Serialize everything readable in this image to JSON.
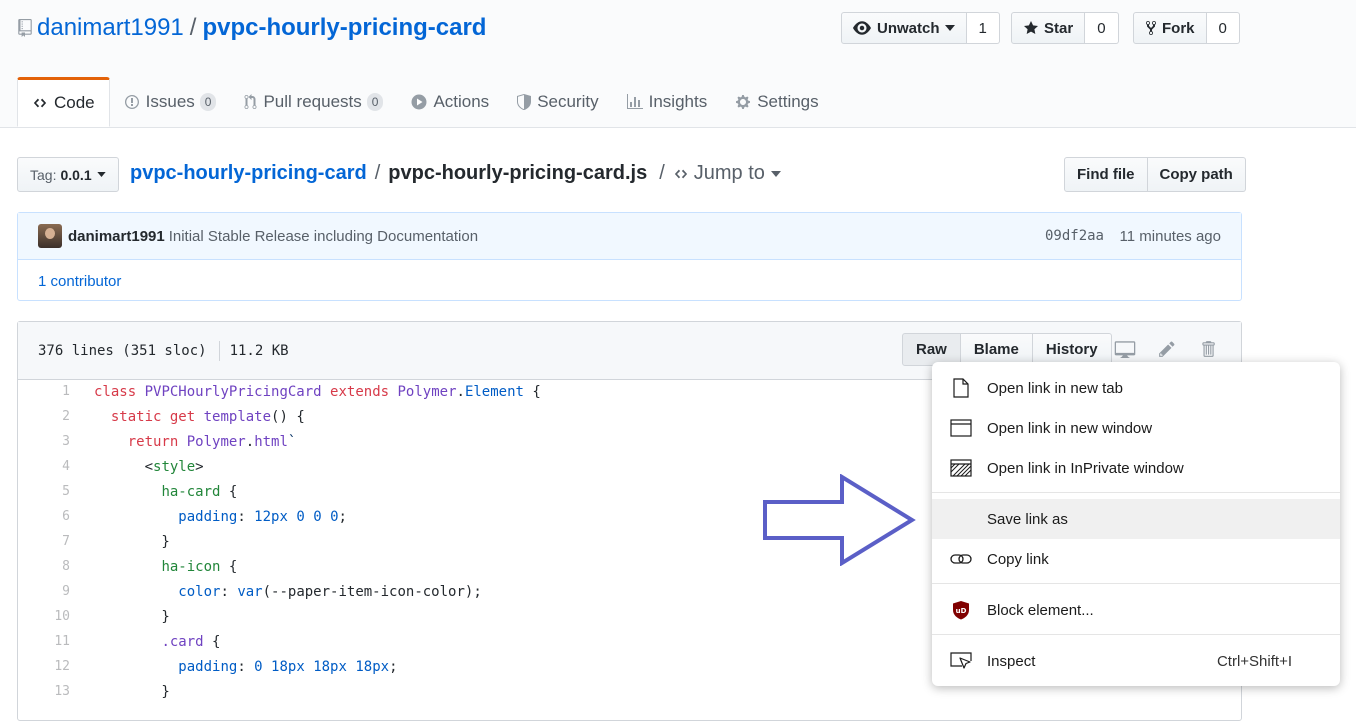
{
  "repo": {
    "owner": "danimart1991",
    "separator": "/",
    "name": "pvpc-hourly-pricing-card",
    "actions": {
      "watch": {
        "label": "Unwatch",
        "count": "1"
      },
      "star": {
        "label": "Star",
        "count": "0"
      },
      "fork": {
        "label": "Fork",
        "count": "0"
      }
    },
    "tabs": [
      {
        "label": "Code",
        "count": ""
      },
      {
        "label": "Issues",
        "count": "0"
      },
      {
        "label": "Pull requests",
        "count": "0"
      },
      {
        "label": "Actions",
        "count": ""
      },
      {
        "label": "Security",
        "count": ""
      },
      {
        "label": "Insights",
        "count": ""
      },
      {
        "label": "Settings",
        "count": ""
      }
    ]
  },
  "filenav": {
    "tag_prefix": "Tag:",
    "tag_value": "0.0.1",
    "crumb_root": "pvpc-hourly-pricing-card",
    "crumb_sep": "/",
    "crumb_file": "pvpc-hourly-pricing-card.js",
    "jump_label": "Jump to",
    "find_file": "Find file",
    "copy_path": "Copy path"
  },
  "commit": {
    "author": "danimart1991",
    "message": "Initial Stable Release including Documentation",
    "sha": "09df2aa",
    "time": "11 minutes ago",
    "contributors": "1 contributor"
  },
  "file": {
    "lines_info": "376 lines (351 sloc)",
    "size": "11.2 KB",
    "raw": "Raw",
    "blame": "Blame",
    "history": "History",
    "line_numbers": [
      "1",
      "2",
      "3",
      "4",
      "5",
      "6",
      "7",
      "8",
      "9",
      "10",
      "11",
      "12",
      "13"
    ]
  },
  "context_menu": {
    "items": [
      {
        "label": "Open link in new tab",
        "icon": "page-icon",
        "shortcut": ""
      },
      {
        "label": "Open link in new window",
        "icon": "window-icon",
        "shortcut": ""
      },
      {
        "label": "Open link in InPrivate window",
        "icon": "inprivate-icon",
        "shortcut": ""
      },
      {
        "label": "Save link as",
        "icon": "",
        "shortcut": ""
      },
      {
        "label": "Copy link",
        "icon": "link-icon",
        "shortcut": ""
      },
      {
        "label": "Block element...",
        "icon": "ublock-icon",
        "shortcut": ""
      },
      {
        "label": "Inspect",
        "icon": "inspect-icon",
        "shortcut": "Ctrl+Shift+I"
      }
    ]
  },
  "colors": {
    "link": "#0366d6",
    "tab_accent": "#e36209",
    "arrow": "#5b5fc7",
    "ublock": "#800000"
  }
}
